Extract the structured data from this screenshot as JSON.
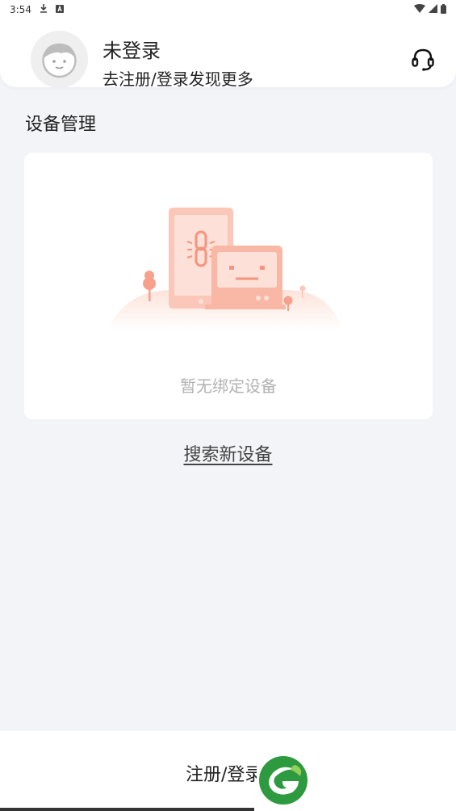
{
  "status_bar": {
    "time": "3:54",
    "download_icon": "download-icon",
    "notification_icon": "a-notification-icon",
    "wifi_icon": "wifi-icon",
    "signal_icon": "signal-icon",
    "battery_icon": "battery-icon"
  },
  "header": {
    "avatar_icon": "avatar-icon",
    "user_name": "未登录",
    "subtitle": "去注册/登录发现更多",
    "support_icon": "headset-icon"
  },
  "devices": {
    "section_title": "设备管理",
    "empty_text": "暂无绑定设备",
    "search_link": "搜索新设备"
  },
  "bottom": {
    "register_label": "注册/登录",
    "logo_icon": "app-logo-icon"
  },
  "colors": {
    "accent": "#f7a08c",
    "logo_green": "#2e9a3f",
    "background": "#f3f4f8"
  }
}
